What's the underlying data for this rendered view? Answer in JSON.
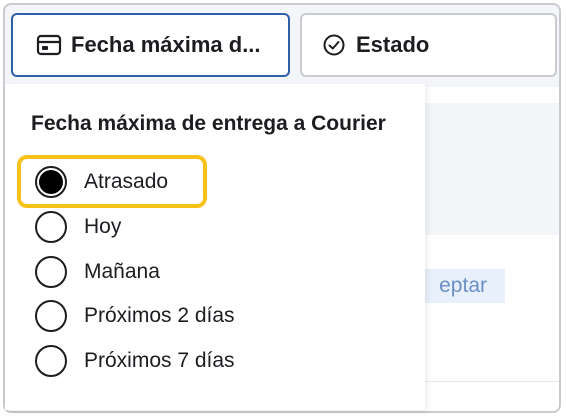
{
  "filters": {
    "date_filter": {
      "label": "Fecha máxima d...",
      "icon": "calendar-icon"
    },
    "status_filter": {
      "label": "Estado",
      "icon": "check-circle-icon"
    }
  },
  "dropdown": {
    "title": "Fecha máxima de entrega a Courier",
    "selected": "Atrasado",
    "options": [
      {
        "label": "Atrasado",
        "checked": true
      },
      {
        "label": "Hoy",
        "checked": false
      },
      {
        "label": "Mañana",
        "checked": false
      },
      {
        "label": "Próximos 2 días",
        "checked": false
      },
      {
        "label": "Próximos 7 días",
        "checked": false
      }
    ]
  },
  "background": {
    "accept_fragment": "eptar"
  },
  "colors": {
    "active_border": "#2f5fa8",
    "highlight": "#f7c21a",
    "text": "#1b1d21"
  }
}
